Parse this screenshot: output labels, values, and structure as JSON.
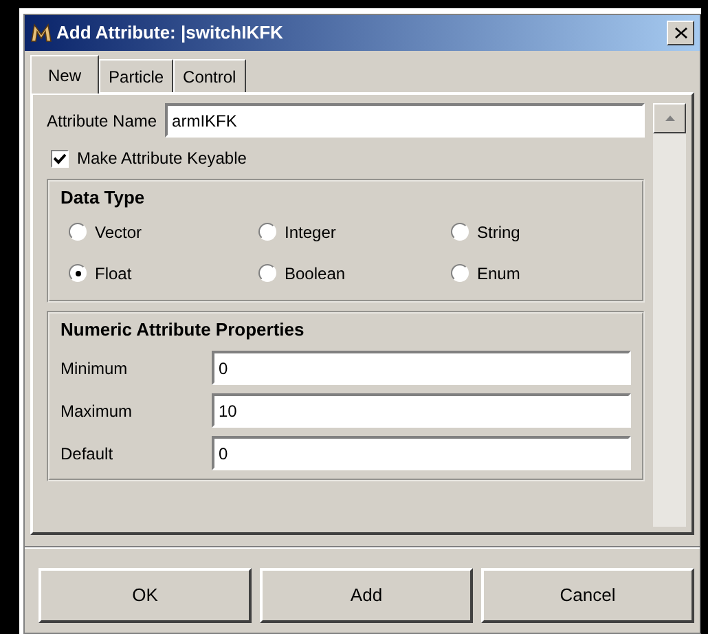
{
  "window": {
    "title": "Add Attribute: |switchIKFK"
  },
  "tabs": [
    {
      "label": "New",
      "selected": true
    },
    {
      "label": "Particle",
      "selected": false
    },
    {
      "label": "Control",
      "selected": false
    }
  ],
  "attribute_name": {
    "label": "Attribute Name",
    "value": "armIKFK"
  },
  "keyable": {
    "label": "Make Attribute Keyable",
    "checked": true
  },
  "data_type": {
    "title": "Data Type",
    "options": [
      {
        "label": "Vector",
        "selected": false
      },
      {
        "label": "Integer",
        "selected": false
      },
      {
        "label": "String",
        "selected": false
      },
      {
        "label": "Float",
        "selected": true
      },
      {
        "label": "Boolean",
        "selected": false
      },
      {
        "label": "Enum",
        "selected": false
      }
    ]
  },
  "numeric_properties": {
    "title": "Numeric Attribute Properties",
    "fields": [
      {
        "label": "Minimum",
        "value": "0"
      },
      {
        "label": "Maximum",
        "value": "10"
      },
      {
        "label": "Default",
        "value": "0"
      }
    ]
  },
  "buttons": [
    "OK",
    "Add",
    "Cancel"
  ]
}
